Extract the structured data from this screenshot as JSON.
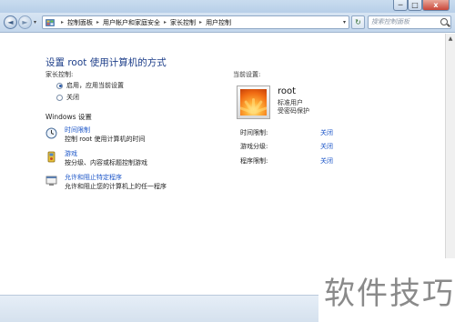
{
  "window": {
    "minimize_glyph": "─",
    "maximize_glyph": "□",
    "close_glyph": "x"
  },
  "address_bar": {
    "back_glyph": "◄",
    "forward_glyph": "►",
    "breadcrumbs": [
      "控制面板",
      "用户帐户和家庭安全",
      "家长控制",
      "用户控制"
    ],
    "separator": "▸",
    "dropdown_glyph": "▾",
    "refresh_glyph": "↻",
    "search_placeholder": "搜索控制面板"
  },
  "main": {
    "title": "设置 root 使用计算机的方式",
    "parental_controls_label": "家长控制:",
    "options": [
      {
        "label": "启用，应用当前设置",
        "checked": true
      },
      {
        "label": "关闭",
        "checked": false
      }
    ],
    "windows_settings_label": "Windows 设置",
    "settings_items": [
      {
        "icon": "clock-icon",
        "link": "时间限制",
        "desc": "控制 root 使用计算机的时间"
      },
      {
        "icon": "game-controller-icon",
        "link": "游戏",
        "desc": "按分级、内容或标题控制游戏"
      },
      {
        "icon": "program-icon",
        "link": "允许和阻止特定程序",
        "desc": "允许和阻止您的计算机上的任一程序"
      }
    ]
  },
  "current_settings": {
    "label": "当前设置:",
    "user_name": "root",
    "user_type": "标准用户",
    "password_status": "受密码保护",
    "rows": [
      {
        "name": "时间限制:",
        "value": "关闭"
      },
      {
        "name": "游戏分级:",
        "value": "关闭"
      },
      {
        "name": "程序限制:",
        "value": "关闭"
      }
    ]
  },
  "watermark": "软件技巧",
  "colors": {
    "title_blue": "#1e3f8a",
    "link_blue": "#1c56c8",
    "close_red": "#c9473a"
  }
}
